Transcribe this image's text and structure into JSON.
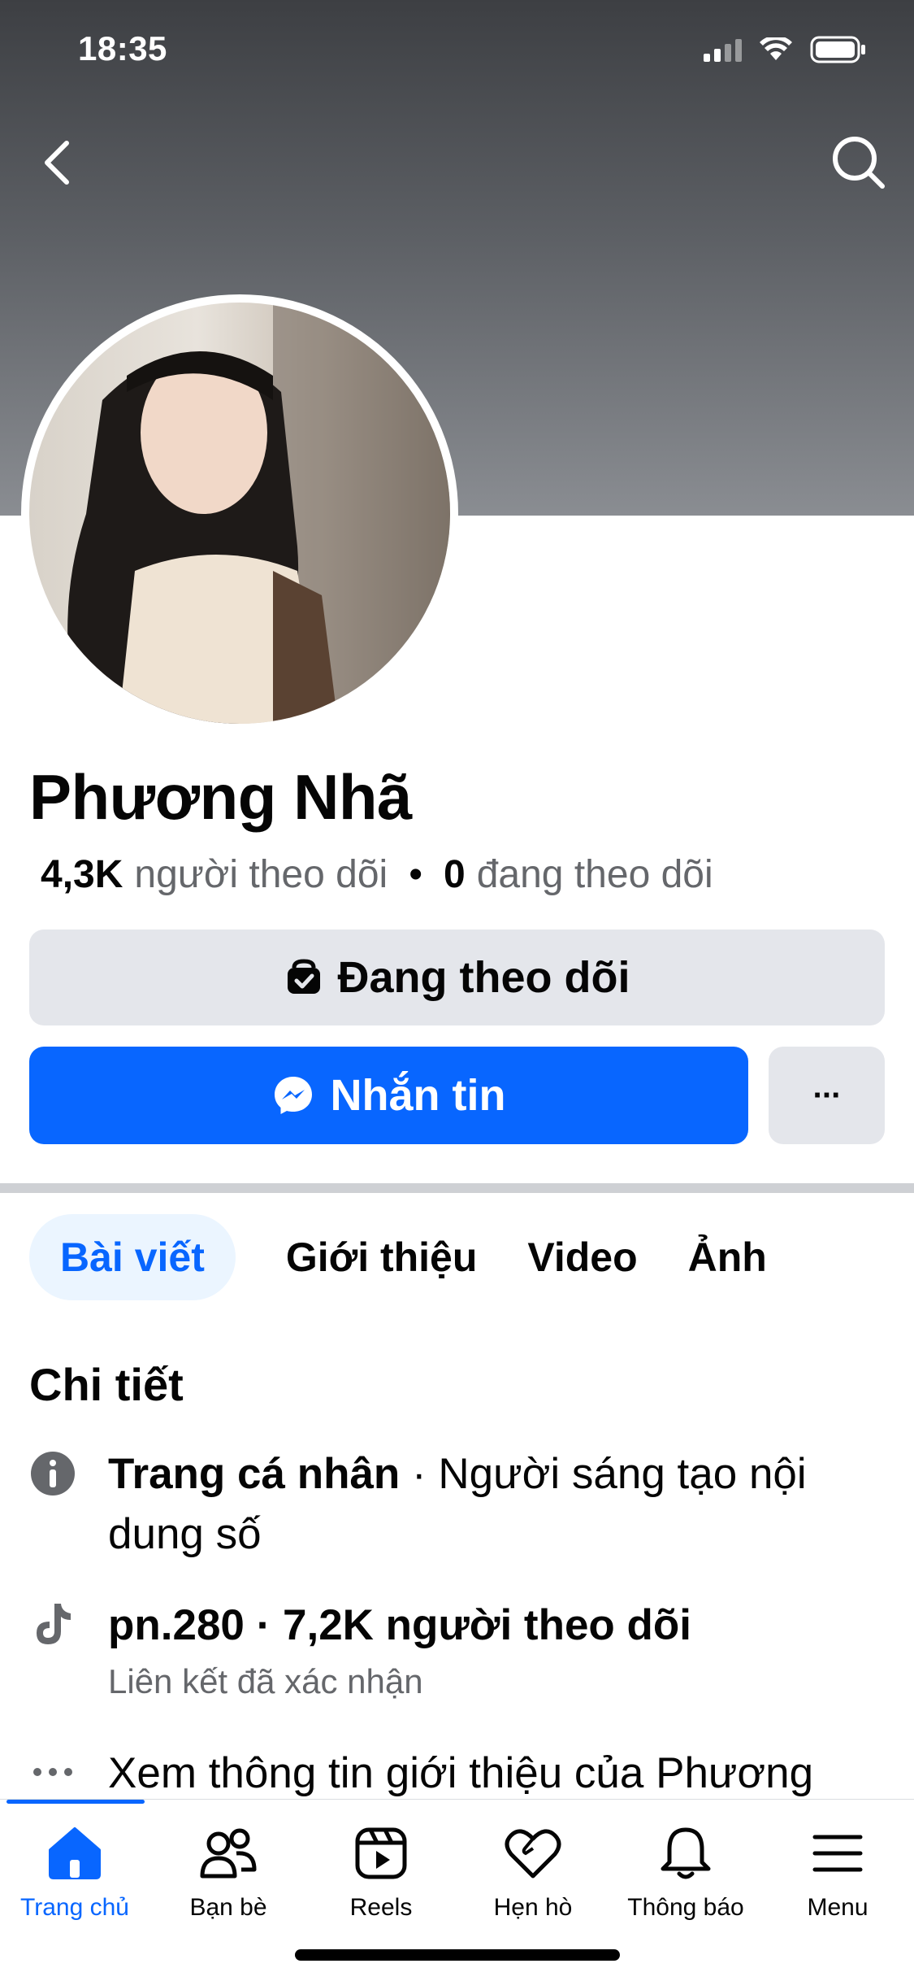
{
  "status_bar": {
    "time": "18:35"
  },
  "profile": {
    "name": "Phương Nhã",
    "followers_count": "4,3K",
    "followers_label": "người theo dõi",
    "following_count": "0",
    "following_label": "đang theo dõi"
  },
  "actions": {
    "following_label": "Đang theo dõi",
    "message_label": "Nhắn tin",
    "more_label": "···"
  },
  "tabs": [
    {
      "label": "Bài viết",
      "active": true
    },
    {
      "label": "Giới thiệu",
      "active": false
    },
    {
      "label": "Video",
      "active": false
    },
    {
      "label": "Ảnh",
      "active": false
    }
  ],
  "details": {
    "title": "Chi tiết",
    "profile_type_bold": "Trang cá nhân",
    "profile_type_rest": " · Người sáng tạo nội dung số",
    "tiktok_handle_line": "pn.280 · 7,2K người theo dõi",
    "tiktok_sub": "Liên kết đã xác nhận",
    "see_more": "Xem thông tin giới thiệu của Phương"
  },
  "bottom_nav": [
    {
      "label": "Trang chủ",
      "icon": "home-icon",
      "active": true
    },
    {
      "label": "Bạn bè",
      "icon": "friends-icon",
      "active": false
    },
    {
      "label": "Reels",
      "icon": "reels-icon",
      "active": false
    },
    {
      "label": "Hẹn hò",
      "icon": "dating-icon",
      "active": false
    },
    {
      "label": "Thông báo",
      "icon": "bell-icon",
      "active": false
    },
    {
      "label": "Menu",
      "icon": "menu-icon",
      "active": false
    }
  ],
  "colors": {
    "accent": "#0866ff",
    "secondary_text": "#65676b",
    "button_gray": "#e4e6eb"
  }
}
